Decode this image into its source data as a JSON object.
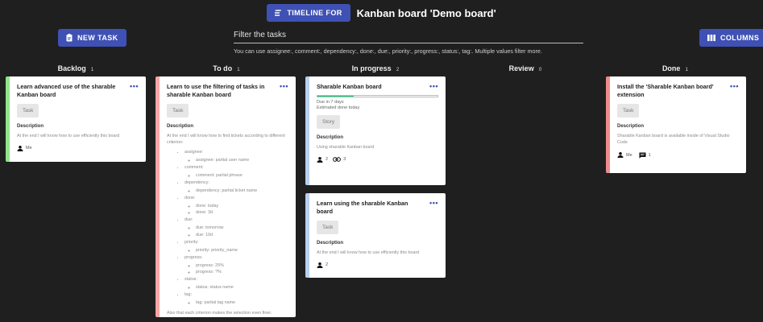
{
  "header": {
    "timeline_label": "TIMELINE FOR",
    "board_title": "Kanban board 'Demo board'"
  },
  "toolbar": {
    "new_task_label": "NEW TASK",
    "columns_label": "COLUMNS"
  },
  "filter": {
    "label": "Filter the tasks",
    "help": "You can use assignee:, comment:, dependency:, done:, due:, priority:, progress:, status:, tag:. Multiple values filter more."
  },
  "columns": [
    {
      "name": "Backlog",
      "count": "1"
    },
    {
      "name": "To do",
      "count": "1"
    },
    {
      "name": "In progress",
      "count": "2"
    },
    {
      "name": "Review",
      "count": "0"
    },
    {
      "name": "Done",
      "count": "1"
    }
  ],
  "colors": {
    "accent": "#3f51b5",
    "backlog": "#8ee58a",
    "todo": "#f4a6a6",
    "progress": "#b9d1f1",
    "done": "#f08a8a",
    "progress_fill": "#1ec774"
  },
  "cards": {
    "backlog": {
      "title": "Learn advanced use of the sharable Kanban board",
      "chip": "Task",
      "desc_title": "Description",
      "desc": "At the end I will know how to use efficiently this board",
      "assignee": "Me"
    },
    "todo": {
      "title": "Learn to use the filtering of tasks in sharable Kanban board",
      "chip": "Task",
      "desc_title": "Description",
      "desc": "At the end I will know how to find tickets according to different criterion:",
      "items": [
        {
          "label": "assignee:",
          "subs": [
            "assignee: partial user name"
          ]
        },
        {
          "label": "comment:",
          "subs": [
            "comment: partial phrase"
          ]
        },
        {
          "label": "dependency:",
          "subs": [
            "dependency: partial ticket name"
          ]
        },
        {
          "label": "done:",
          "subs": [
            "done: today",
            "done: 3d"
          ]
        },
        {
          "label": "due:",
          "subs": [
            "due: tomorrow",
            "due: 10d"
          ]
        },
        {
          "label": "priority:",
          "subs": [
            "priority: priority_name"
          ]
        },
        {
          "label": "progress:",
          "subs": [
            "progress: 25%",
            "progress: ?%"
          ]
        },
        {
          "label": "status:",
          "subs": [
            "status: status name"
          ]
        },
        {
          "label": "tag:",
          "subs": [
            "tag: partial tag name"
          ]
        }
      ],
      "outro": "Also that each criterion makes the selection even finer.",
      "assignee_count": "2"
    },
    "progress1": {
      "title": "Sharable Kanban board",
      "progress": 0.3,
      "due": "Due in 7 days",
      "estimate": "Estimated done today",
      "chip": "Story",
      "desc_title": "Description",
      "desc": "Using sharable Kanban board",
      "assignee_count": "2",
      "link_count": "3"
    },
    "progress2": {
      "title": "Learn using the sharable Kanban board",
      "chip": "Task",
      "desc_title": "Description",
      "desc": "At the end I will know how to use efficiently this board",
      "assignee_count": "2"
    },
    "done": {
      "title": "Install the 'Sharable Kanban board' extension",
      "chip": "Task",
      "desc_title": "Description",
      "desc": "Sharable Kanban board is available inside of Visual Studio Code",
      "assignee": "Me",
      "comment_count": "1"
    }
  }
}
